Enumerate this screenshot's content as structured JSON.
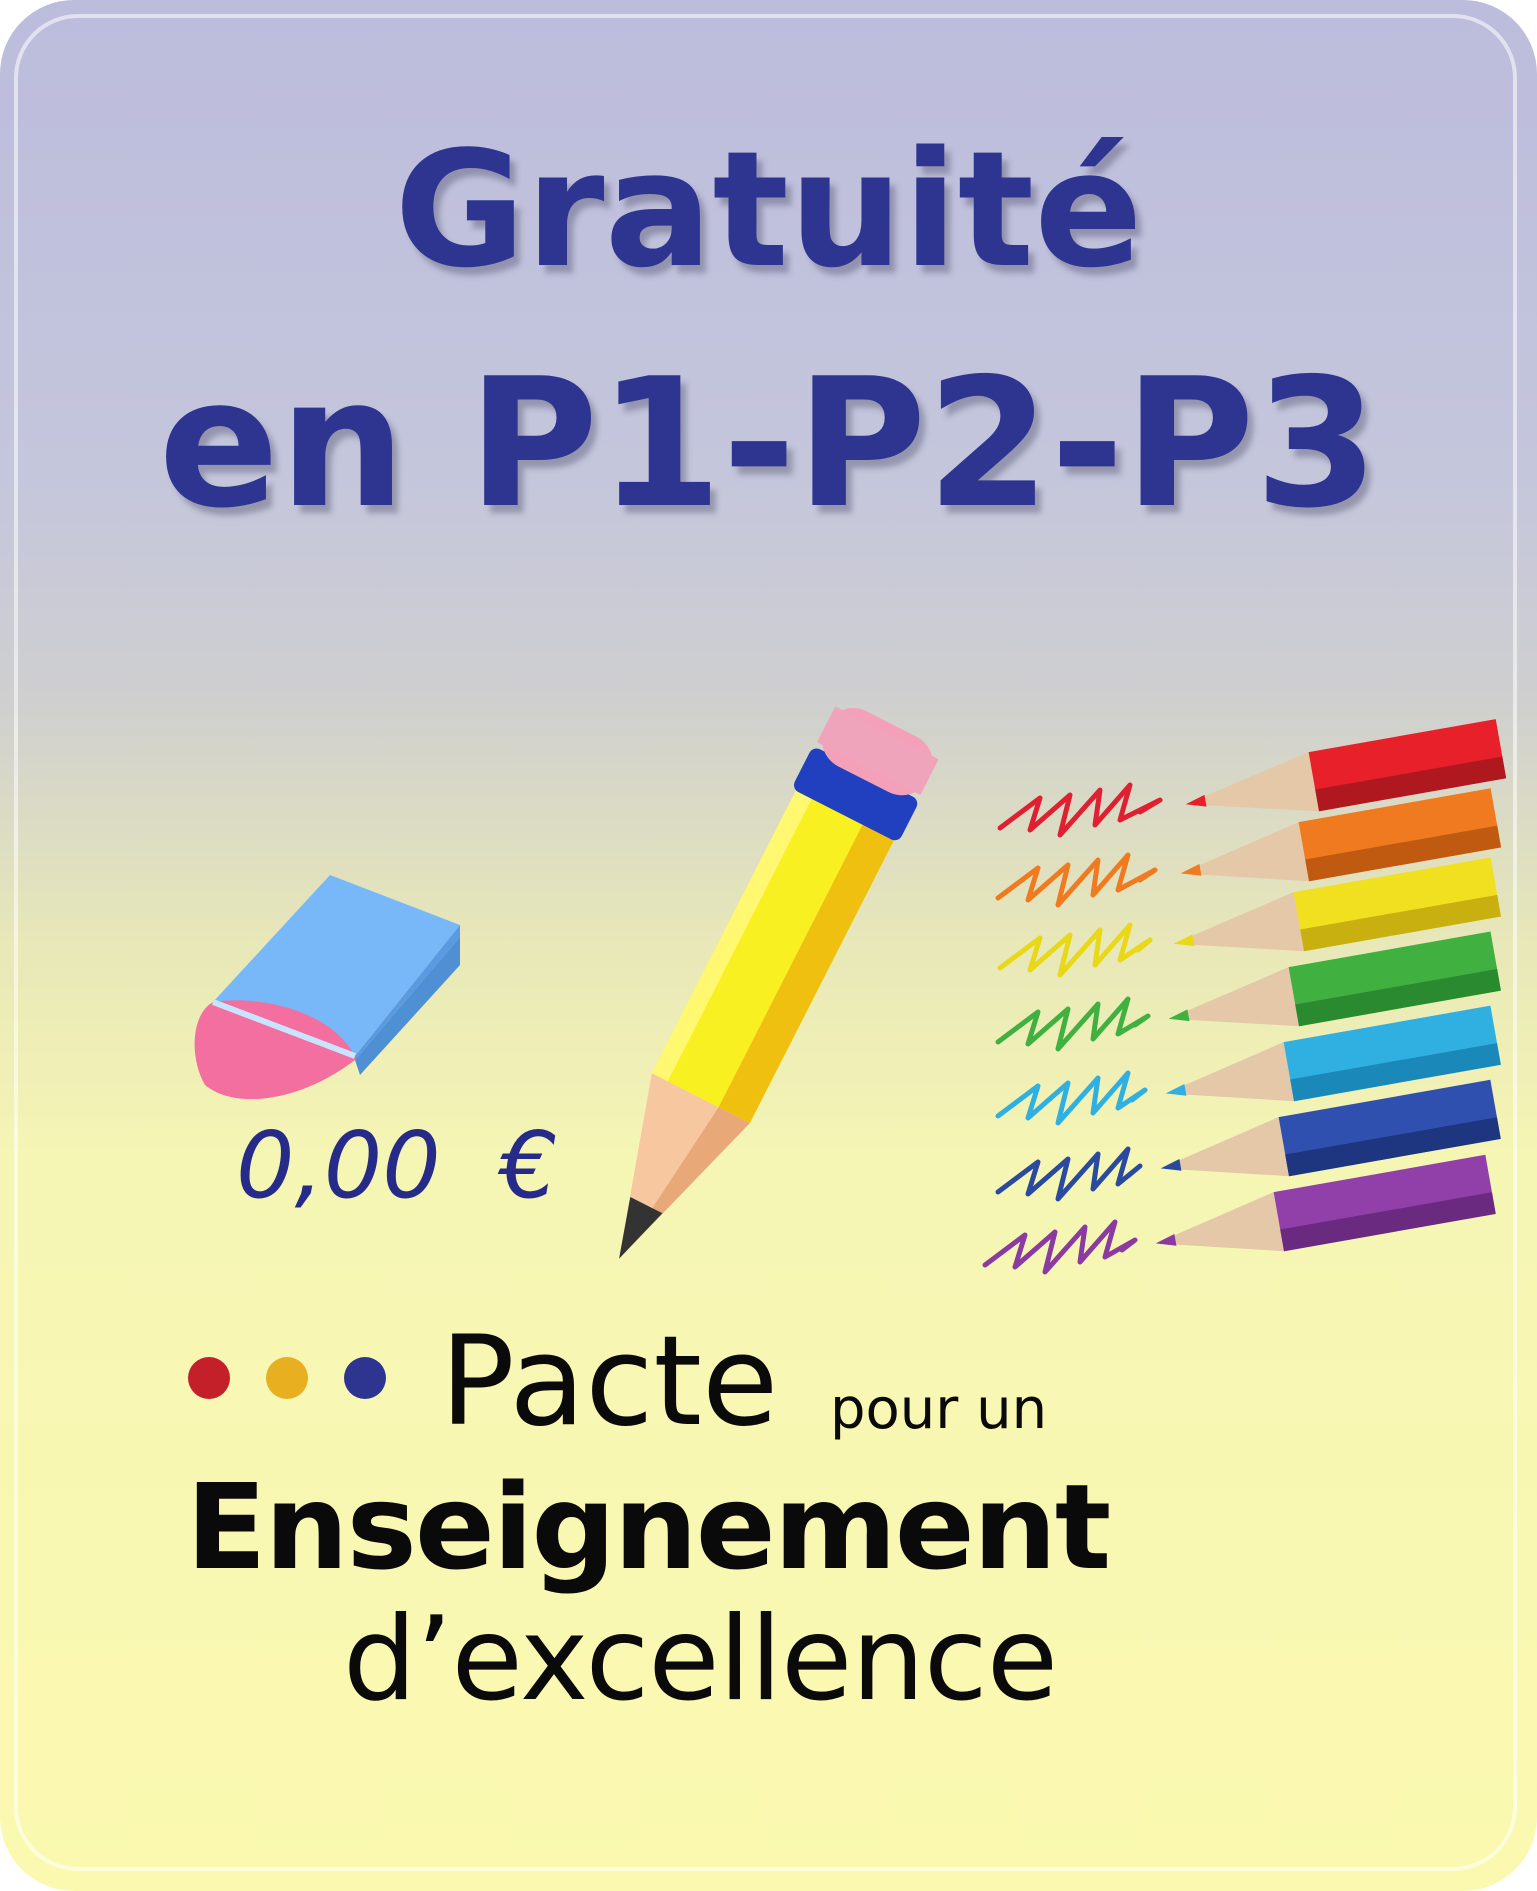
{
  "title": {
    "line1": "Gratuité",
    "line2": "en P1-P2-P3"
  },
  "price": "0,00  €",
  "logo": {
    "pacte": "Pacte",
    "pour_un": "pour un",
    "enseignement": "Enseignement",
    "excellence": "d’excellence",
    "dot_colors": [
      "#c4202a",
      "#e8b020",
      "#2e3590"
    ]
  },
  "illustrations": {
    "eraser": "eraser-icon",
    "pencil": "pencil-icon",
    "colored_pencils": "colored-pencils-icon"
  },
  "colors": {
    "title_blue": "#2e3590",
    "price_blue": "#262b8a",
    "pencil_colors": [
      "#e8202a",
      "#f07a20",
      "#f0e020",
      "#40b040",
      "#30b0e0",
      "#2a4aa0",
      "#8a3aa0"
    ]
  }
}
